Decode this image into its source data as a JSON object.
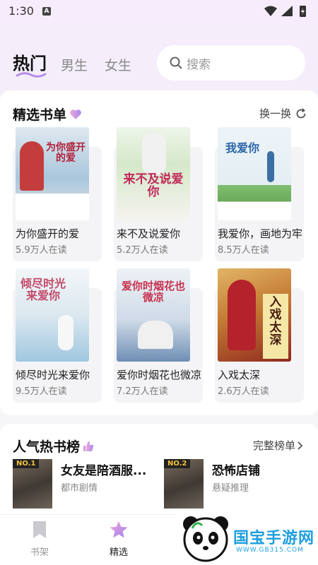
{
  "status_bar": {
    "time": "1:30",
    "badge": "A"
  },
  "tabs": {
    "hot": "热门",
    "boys": "男生",
    "girls": "女生"
  },
  "search": {
    "placeholder": "搜索"
  },
  "featured": {
    "title": "精选书单",
    "refresh_label": "换一换",
    "books": [
      {
        "name": "为你盛开的爱",
        "readers": "5.9万人在读",
        "cover_text": "为你盛开的爱",
        "cover_colors": [
          "#cfe3ef",
          "#7ea9c9"
        ]
      },
      {
        "name": "来不及说爱你",
        "readers": "5.2万人在读",
        "cover_text": "来不及说爱你",
        "cover_colors": [
          "#e9f2e4",
          "#b9d3ac"
        ]
      },
      {
        "name": "我爱你，画地为牢",
        "readers": "8.5万人在读",
        "cover_text": "我爱你",
        "cover_colors": [
          "#eaf3f8",
          "#8fc28a"
        ]
      },
      {
        "name": "倾尽时光来爱你",
        "readers": "9.5万人在读",
        "cover_text": "倾尽时光来爱你",
        "cover_colors": [
          "#f3f6f8",
          "#9fc7df"
        ]
      },
      {
        "name": "爱你时烟花也微凉",
        "readers": "7.2万人在读",
        "cover_text": "爱你时烟花也微凉",
        "cover_colors": [
          "#e9eff5",
          "#8aa9c8"
        ]
      },
      {
        "name": "入戏太深",
        "readers": "2.6万人在读",
        "cover_text": "入戏太深",
        "cover_colors": [
          "#d9a34a",
          "#8f2a1f"
        ]
      }
    ]
  },
  "ranking": {
    "title": "人气热书榜",
    "more_label": "完整榜单",
    "items": [
      {
        "rank": "NO.1",
        "title": "女友是陪酒服...",
        "genre": "都市剧情"
      },
      {
        "rank": "NO.2",
        "title": "恐怖店铺",
        "genre": "悬疑推理"
      }
    ]
  },
  "bottom_nav": {
    "shelf": "书架",
    "pick": "精选"
  },
  "watermark": {
    "text": "国宝手游网",
    "sub": "WWW.GB315.COM"
  },
  "colors": {
    "accent_pink": "#f19bd9",
    "accent_purple": "#9a7cf0",
    "watermark_blue": "#1e9ee0"
  }
}
